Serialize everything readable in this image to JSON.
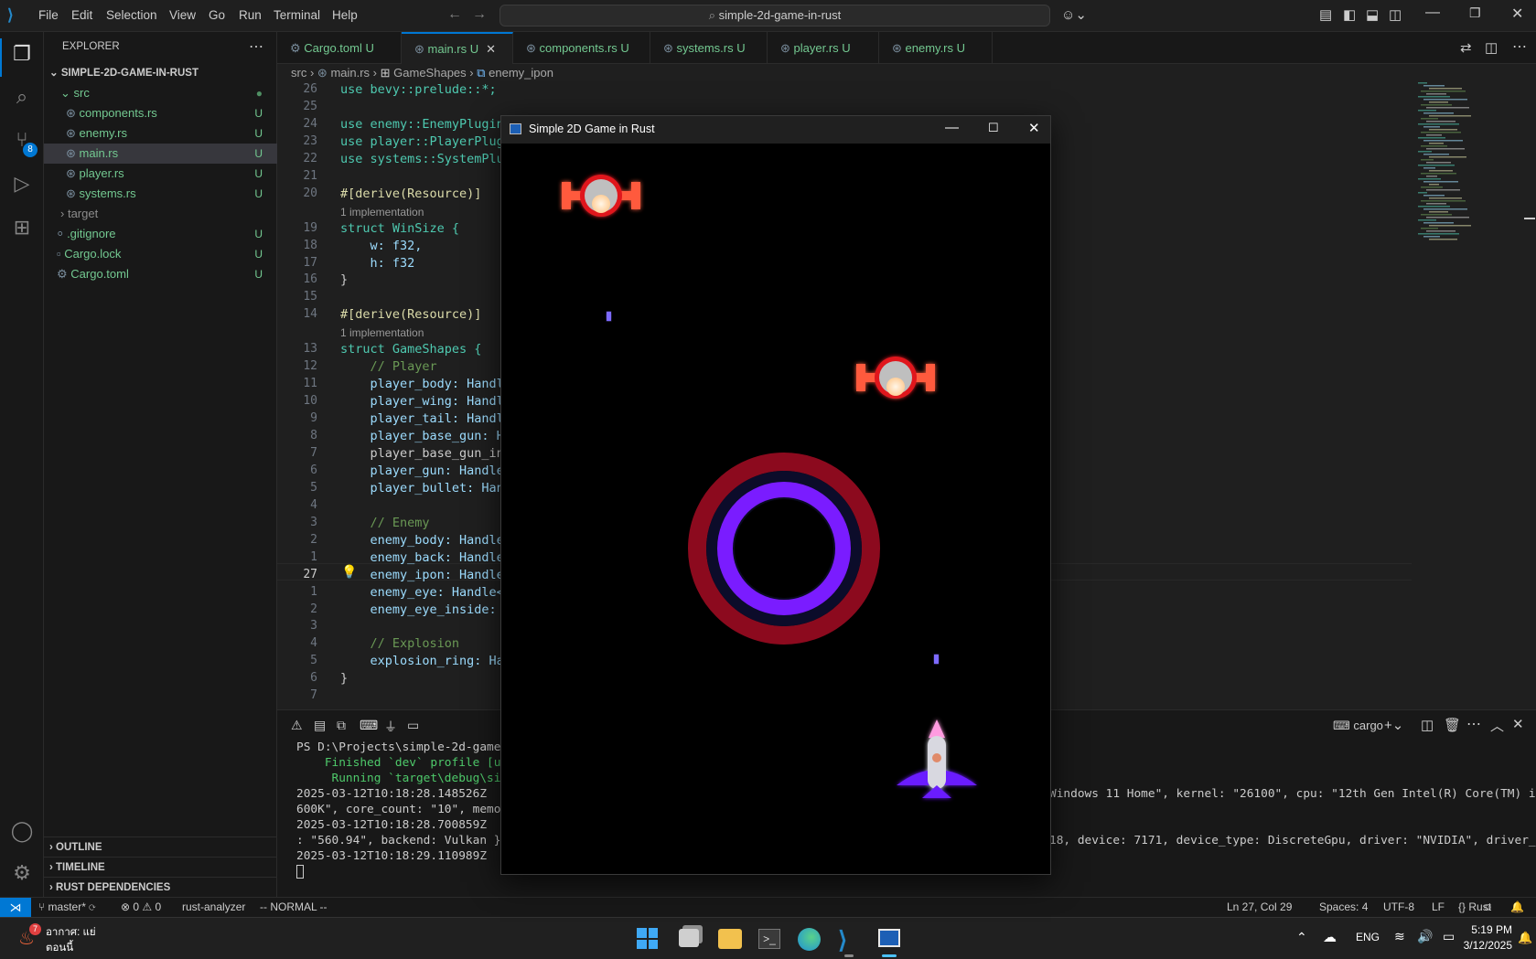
{
  "menu": [
    "File",
    "Edit",
    "Selection",
    "View",
    "Go",
    "Run",
    "Terminal",
    "Help"
  ],
  "command_center": "simple-2d-game-in-rust",
  "explorer": {
    "title": "EXPLORER",
    "root": "SIMPLE-2D-GAME-IN-RUST",
    "items": [
      {
        "label": "src",
        "badge": ""
      },
      {
        "label": "components.rs",
        "badge": "U"
      },
      {
        "label": "enemy.rs",
        "badge": "U"
      },
      {
        "label": "main.rs",
        "badge": "U"
      },
      {
        "label": "player.rs",
        "badge": "U"
      },
      {
        "label": "systems.rs",
        "badge": "U"
      },
      {
        "label": "target",
        "badge": ""
      },
      {
        "label": ".gitignore",
        "badge": "U"
      },
      {
        "label": "Cargo.lock",
        "badge": "U"
      },
      {
        "label": "Cargo.toml",
        "badge": "U"
      }
    ],
    "sections": [
      "OUTLINE",
      "TIMELINE",
      "RUST DEPENDENCIES"
    ]
  },
  "scm_badge": "8",
  "tabs": [
    {
      "label": "Cargo.toml",
      "badge": "U"
    },
    {
      "label": "main.rs",
      "badge": "U"
    },
    {
      "label": "components.rs",
      "badge": "U"
    },
    {
      "label": "systems.rs",
      "badge": "U"
    },
    {
      "label": "player.rs",
      "badge": "U"
    },
    {
      "label": "enemy.rs",
      "badge": "U"
    }
  ],
  "breadcrumb": [
    "src",
    "main.rs",
    "GameShapes",
    "enemy_ipon"
  ],
  "code_lines": [
    {
      "n": "26",
      "t": "use bevy::prelude::*;"
    },
    {
      "n": "25",
      "t": ""
    },
    {
      "n": "24",
      "t": "use enemy::EnemyPlugin;"
    },
    {
      "n": "23",
      "t": "use player::PlayerPlugi"
    },
    {
      "n": "22",
      "t": "use systems::SystemPlug"
    },
    {
      "n": "21",
      "t": ""
    },
    {
      "n": "20",
      "t": "#[derive(Resource)]"
    },
    {
      "n": "",
      "t": "1 implementation",
      "hint": true
    },
    {
      "n": "19",
      "t": "struct WinSize {"
    },
    {
      "n": "18",
      "t": "    w: f32,"
    },
    {
      "n": "17",
      "t": "    h: f32"
    },
    {
      "n": "16",
      "t": "}"
    },
    {
      "n": "15",
      "t": ""
    },
    {
      "n": "14",
      "t": "#[derive(Resource)]"
    },
    {
      "n": "",
      "t": "1 implementation",
      "hint": true
    },
    {
      "n": "13",
      "t": "struct GameShapes {"
    },
    {
      "n": "12",
      "t": "    // Player"
    },
    {
      "n": "11",
      "t": "    player_body: Handle"
    },
    {
      "n": "10",
      "t": "    player_wing: Handle"
    },
    {
      "n": "9",
      "t": "    player_tail: Handle"
    },
    {
      "n": "8",
      "t": "    player_base_gun: Ha"
    },
    {
      "n": "7",
      "t": "    player_base_gun_ins"
    },
    {
      "n": "6",
      "t": "    player_gun: Handle<"
    },
    {
      "n": "5",
      "t": "    player_bullet: Hand"
    },
    {
      "n": "4",
      "t": ""
    },
    {
      "n": "3",
      "t": "    // Enemy"
    },
    {
      "n": "2",
      "t": "    enemy_body: Handle<"
    },
    {
      "n": "1",
      "t": "    enemy_back: Handle<"
    },
    {
      "n": "27",
      "t": "    enemy_ipon: Handle<"
    },
    {
      "n": "1",
      "t": "    enemy_eye: Handle<M"
    },
    {
      "n": "2",
      "t": "    enemy_eye_inside: H"
    },
    {
      "n": "3",
      "t": ""
    },
    {
      "n": "4",
      "t": "    // Explosion"
    },
    {
      "n": "5",
      "t": "    explosion_ring: Han"
    },
    {
      "n": "6",
      "t": "}"
    },
    {
      "n": "7",
      "t": ""
    }
  ],
  "terminal": {
    "profile": "cargo",
    "lines": [
      "PS D:\\Projects\\simple-2d-game-in",
      "    Finished `dev` profile [unop",
      "     Running `target\\debug\\simpl",
      "2025-03-12T10:18:28.148526Z  INF",
      "600K\", core_count: \"10\", memory:",
      "2025-03-12T10:18:28.700859Z  INF",
      ": \"560.94\", backend: Vulkan }",
      "2025-03-12T10:18:29.110989Z  INF"
    ],
    "right_lines": [
      "Windows 11 Home\", kernel: \"26100\", cpu: \"12th Gen Intel(R) Core(TM) i5-12",
      "",
      "",
      "18, device: 7171, device_type: DiscreteGpu, driver: \"NVIDIA\", driver_info"
    ]
  },
  "game_window": {
    "title": "Simple 2D Game in Rust",
    "colors": {
      "enemy_red": "#e0141f",
      "ring_red": "#8c0a1e",
      "ring_purple": "#7a1cff",
      "player": "#6a1cff"
    }
  },
  "status": {
    "branch": "master*",
    "errors": "0",
    "warnings": "0",
    "analyzer": "rust-analyzer",
    "mode": "-- NORMAL --",
    "position": "Ln 27, Col 29",
    "spaces": "Spaces: 4",
    "encoding": "UTF-8",
    "eol": "LF",
    "language": "Rust"
  },
  "taskbar": {
    "weather_line1": "อากาศ: แย่",
    "weather_line2": "ตอนนี้",
    "weather_badge": "7",
    "lang": "ENG",
    "time": "5:19 PM",
    "date": "3/12/2025"
  }
}
